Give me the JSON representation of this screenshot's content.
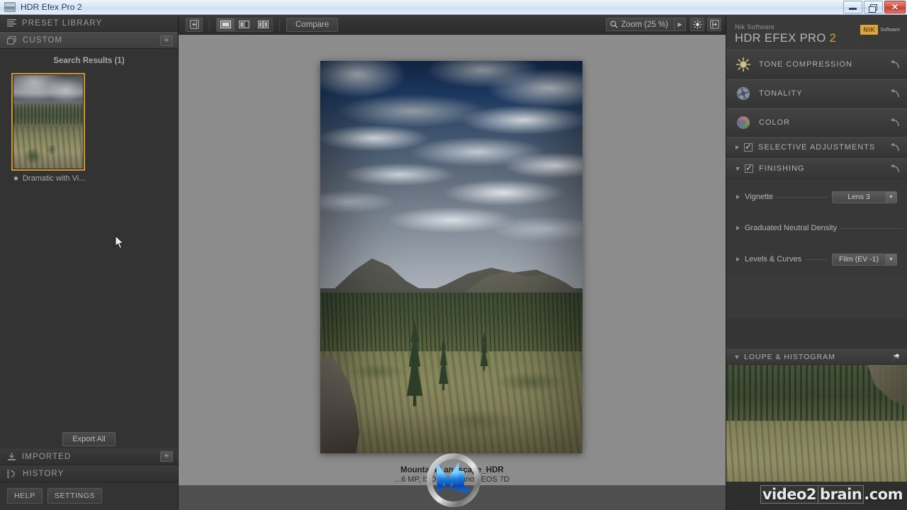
{
  "window": {
    "title": "HDR Efex Pro 2",
    "icon": "app-icon",
    "buttons": {
      "minimize": "–",
      "maximize": "❐",
      "close": "✕"
    }
  },
  "left_panel": {
    "preset_library": {
      "label": "PRESET LIBRARY",
      "icon": "list-lines-icon"
    },
    "custom": {
      "label": "CUSTOM",
      "icon": "stacked-pages-icon",
      "add_label": "+"
    },
    "search_results": "Search Results (1)",
    "presets": [
      {
        "name": "Dramatic with Vi...",
        "favorite_icon": "star-icon",
        "selected": true
      }
    ],
    "export_all": "Export All",
    "imported": {
      "label": "IMPORTED",
      "icon": "import-arrow-icon",
      "add_label": "+"
    },
    "history": {
      "label": "HISTORY",
      "icon": "history-icon"
    },
    "help": "HELP",
    "settings": "SETTINGS",
    "cursor": "mouse-pointer"
  },
  "toolbar": {
    "back_icon": "exit-arrow-icon",
    "view_modes": [
      {
        "name": "single-view",
        "icon": "single-pane-icon",
        "active": true
      },
      {
        "name": "split-view",
        "icon": "split-pane-icon",
        "active": false
      },
      {
        "name": "side-by-side-view",
        "icon": "dual-pane-icon",
        "active": false
      }
    ],
    "compare": "Compare",
    "zoom": {
      "icon": "magnifier-icon",
      "label": "Zoom (25 %)",
      "value": "25 %",
      "arrow": "▶"
    },
    "brightness_icon": "sun-burst-icon",
    "exit_icon": "exit-door-icon"
  },
  "canvas": {
    "image_title": "Mountain Landscape_HDR",
    "image_info": "...6 MP, ISO 400, Canon EOS 7D",
    "logo": "nik-m-logo"
  },
  "right_panel": {
    "brand_small": "Nik Software",
    "brand_main": "HDR EFEX PRO",
    "brand_version": "2",
    "nik_logo": {
      "mark": "NIK",
      "word": "Software"
    },
    "sections": [
      {
        "label": "TONE COMPRESSION",
        "icon": "sun-icon",
        "reset": "reset-icon",
        "has_checkbox": false,
        "expanded": false
      },
      {
        "label": "TONALITY",
        "icon": "aperture-icon",
        "reset": "reset-icon",
        "has_checkbox": false,
        "expanded": false
      },
      {
        "label": "COLOR",
        "icon": "color-wheel-icon",
        "reset": "reset-icon",
        "has_checkbox": false,
        "expanded": false
      },
      {
        "label": "SELECTIVE ADJUSTMENTS",
        "icon": "",
        "reset": "reset-icon",
        "has_checkbox": true,
        "checked": true,
        "expanded": false
      },
      {
        "label": "FINISHING",
        "icon": "",
        "reset": "reset-icon",
        "has_checkbox": true,
        "checked": true,
        "expanded": true
      }
    ],
    "finishing_items": [
      {
        "label": "Vignette",
        "value": "Lens 3",
        "has_combo": true
      },
      {
        "label": "Graduated Neutral Density",
        "value": "",
        "has_combo": false
      },
      {
        "label": "Levels & Curves",
        "value": "Film (EV -1)",
        "has_combo": true
      }
    ],
    "loupe": {
      "label": "LOUPE & HISTOGRAM",
      "pin_icon": "pin-icon",
      "collapse_icon": "chevron-down-icon"
    }
  },
  "watermark": {
    "part_a": "video2",
    "part_b": "brain",
    "part_c": ".com"
  },
  "colors": {
    "accent_orange": "#d9a23a",
    "panel_bg": "#3a3a3a",
    "canvas_bg": "#8c8c8c",
    "text_primary": "#b6b6b6",
    "selection_border": "#d19a32"
  }
}
